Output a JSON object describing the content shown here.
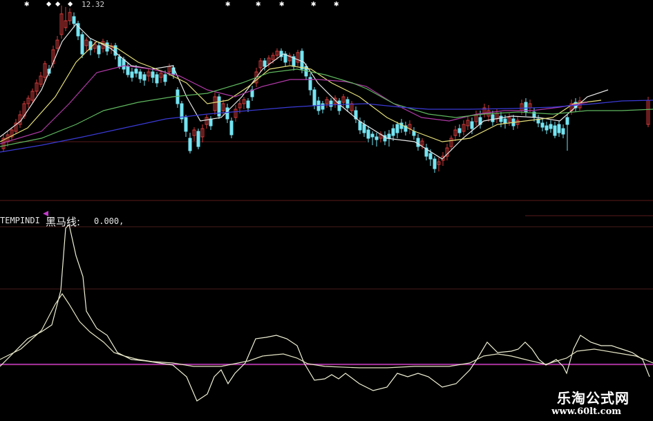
{
  "upper_panel": {
    "high_price_label": "12.32",
    "colors": {
      "bg": "#000000",
      "up_candle": "#d23a3a",
      "down_candle": "#74e4f2",
      "ma_white": "#e8e8e8",
      "ma_yellow": "#e6e07a",
      "ma_magenta": "#b23aa8",
      "ma_green": "#5fb85f",
      "ma_blue": "#3a3ad8",
      "grid": "#5a1a1a"
    }
  },
  "indicator_panel": {
    "name": "TEMPINDI",
    "formula_label": "黑马线:",
    "value": "0.000,",
    "colors": {
      "line_main": "#f2f2d8",
      "line_secondary": "#e6e6c6",
      "zero_line": "#c23ac8",
      "grid": "#4a1a1a"
    }
  },
  "watermark": {
    "site_name": "乐淘公式网",
    "url": "www.60lt.com"
  }
}
